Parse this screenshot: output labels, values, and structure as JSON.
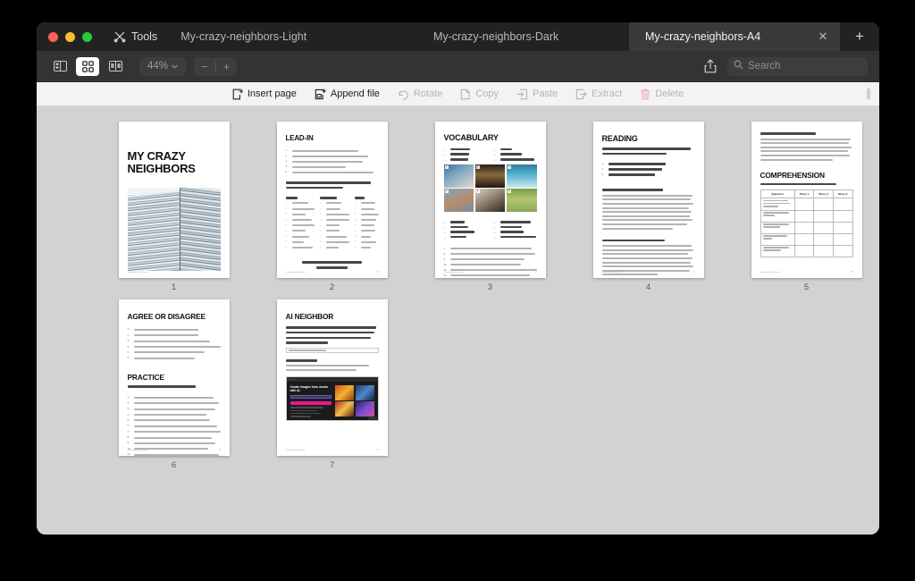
{
  "window": {
    "traffic_lights": [
      "close",
      "minimize",
      "zoom"
    ],
    "tools_label": "Tools",
    "tabs": [
      {
        "label": "My-crazy-neighbors-Light",
        "active": false,
        "closable": false
      },
      {
        "label": "My-crazy-neighbors-Dark",
        "active": false,
        "closable": false
      },
      {
        "label": "My-crazy-neighbors-A4",
        "active": true,
        "closable": true
      }
    ],
    "new_tab_label": "+"
  },
  "toolbar": {
    "view_modes": [
      {
        "name": "sidebar-view",
        "active": false
      },
      {
        "name": "grid-view",
        "active": true
      },
      {
        "name": "two-page-view",
        "active": false
      }
    ],
    "zoom_level": "44%",
    "zoom_out_label": "−",
    "zoom_sep": "|",
    "zoom_in_label": "+",
    "share_icon": "share-icon",
    "search": {
      "placeholder": "Search",
      "value": ""
    }
  },
  "actionbar": {
    "items": [
      {
        "label": "Insert page",
        "icon": "insert-page-icon",
        "enabled": true
      },
      {
        "label": "Append file",
        "icon": "append-file-icon",
        "enabled": true
      },
      {
        "label": "Rotate",
        "icon": "rotate-icon",
        "enabled": false
      },
      {
        "label": "Copy",
        "icon": "copy-icon",
        "enabled": false
      },
      {
        "label": "Paste",
        "icon": "paste-icon",
        "enabled": false
      },
      {
        "label": "Extract",
        "icon": "extract-icon",
        "enabled": false
      },
      {
        "label": "Delete",
        "icon": "trash-icon",
        "enabled": false
      }
    ]
  },
  "pages": [
    {
      "number": "1",
      "kind": "cover",
      "title": "MY CRAZY NEIGHBORS",
      "footer": "Created by ESL Brains",
      "page_label": ""
    },
    {
      "number": "2",
      "kind": "lead-in",
      "heading": "LEAD-IN",
      "questions": [
        "What do you like most about your neighbors?",
        "Have you ever had a difficult neighbor? How did you handle it?",
        "Do you prefer living in an apartment building or a house? Why?",
        "What are some good qualities of a neighbor?",
        "What are some reasons you might call the police because of a neighbor?"
      ],
      "instruction": "Pick one noun, one adjective, and one verb to describe the word neighbor and explain why you chose them.",
      "columns": [
        {
          "header": "Nouns",
          "items": [
            "Noise",
            "Argument",
            "Mess",
            "Problem",
            "Neighbor",
            "Fight",
            "Drama",
            "Pets",
            "Children"
          ]
        },
        {
          "header": "Adjectives",
          "items": [
            "Noisy",
            "Rude",
            "Unfriendly",
            "Troublemaking",
            "Nosy",
            "Loud",
            "Talkative",
            "Aggressive",
            "Lazy"
          ]
        },
        {
          "header": "Verbs",
          "items": [
            "Knock",
            "Ignore",
            "Complain",
            "Disturb",
            "Shout",
            "Throw",
            "Talk",
            "Dance",
            "Play"
          ]
        }
      ],
      "closing": "Would you say you're a good neighbor? Why or why not?",
      "footer": "Created by ESL Brains",
      "page_label": "2"
    },
    {
      "number": "3",
      "kind": "vocabulary",
      "heading": "VOCABULARY",
      "word_bank_top_left": [
        "throw",
        "knock",
        "shout"
      ],
      "word_bank_top_right": [
        "pile",
        "hallway",
        "hold one's breath"
      ],
      "photos": [
        {
          "badge": "1",
          "alt": "person hanging laundry"
        },
        {
          "badge": "2",
          "alt": "dim apartment hallway"
        },
        {
          "badge": "3",
          "alt": "surfer riding a wave"
        },
        {
          "badge": "4",
          "alt": "portrait of a man"
        },
        {
          "badge": "5",
          "alt": "people arguing indoors"
        },
        {
          "badge": "6",
          "alt": "pile of trash outdoors"
        }
      ],
      "word_bank_bottom_left": [
        "calm",
        "stress",
        "confused",
        "avoid"
      ],
      "word_bank_bottom_right": [
        "banging noise",
        "find out",
        "knock down",
        "heated argument"
      ],
      "questions": [
        "What word describes a peaceful and quiet situation?",
        "What do you call a loud, heavy sound, like something being hit?",
        "What do you do when you discover new information?",
        "What do you call a very angry discussion or fight?",
        "What word describes how you feel when you don't understand something?",
        "What do you do when you stay away from something or someone?",
        "What do you call someone who collects a lot of things, even trash?",
        "What word describes the feeling of pressure or worry?"
      ],
      "footer": "Created by ESL Brains",
      "page_label": "3"
    },
    {
      "number": "4",
      "kind": "reading",
      "heading": "READING",
      "intro": "You're going to read 3 stories about strange neighbors. Look at the titles. What do you think each one is about?",
      "titles": [
        "Calling the Police for Strange Things",
        "Never Fighting with a Neighbor Again",
        "The Trash Hoarder in My Building"
      ],
      "story1_heading": "1. Calling the Police for Strange Things",
      "story2_heading": "2. Never Fighting with a Neighbor Again",
      "footer": "Created by ESL Brains",
      "page_label": "4"
    },
    {
      "number": "5",
      "kind": "comprehension",
      "story3_heading": "3. The Trash Hoarder in My Building",
      "heading": "COMPREHENSION",
      "instruction": "Complete the table with information from the stories.",
      "table": {
        "headers": [
          "Question",
          "Story 1",
          "Story 2",
          "Story 3"
        ],
        "rows": [
          "What problem does the person have with their neighbor?",
          "How does the person react?",
          "Do they talk directly to the neighbor?",
          "What happens after they ask?",
          "How does the problem affect the person?"
        ]
      },
      "footer": "Created by ESL Brains",
      "page_label": "5"
    },
    {
      "number": "6",
      "kind": "agree-practice",
      "heading": "AGREE OR DISAGREE",
      "statements": [
        "It's always better to stay calm when you're upset.",
        "It's always better to stay calm when you're upset.",
        "Throwing things when you're angry is sometimes a good idea.",
        "If someone knocks on your door late at night, it's probably an emergency.",
        "Having an argument with a neighbor is a waste of time.",
        "Heated debates are a good way to solve problems."
      ],
      "heading2": "PRACTICE",
      "instruction2": "Add the missing vowels to complete the words.",
      "footer": "Created by ESL Brains",
      "page_label": "6"
    },
    {
      "number": "7",
      "kind": "ai-neighbor",
      "heading": "AI NEIGHBOR",
      "instruction": "Using the words from this lesson, open the website and create an AI image of a bad neighbor. Let your classmates describe what's happening in the image, and then see if it matches what you wanted to show.",
      "link_label": "https://www.bing.com/images/create",
      "prompt_label": "Example prompt:",
      "prompt_text": "\"Create an image of a bad neighbor angrily throwing furniture in an apartment hallway, causing a mess.\"",
      "shot": {
        "title": "Create images from words with AI",
        "button_label": "Join & Create",
        "tiles": [
          "orange-art",
          "blue-art",
          "red-art",
          "purple-art"
        ]
      },
      "footer": "Created by ESL Brains",
      "page_label": "7"
    }
  ]
}
